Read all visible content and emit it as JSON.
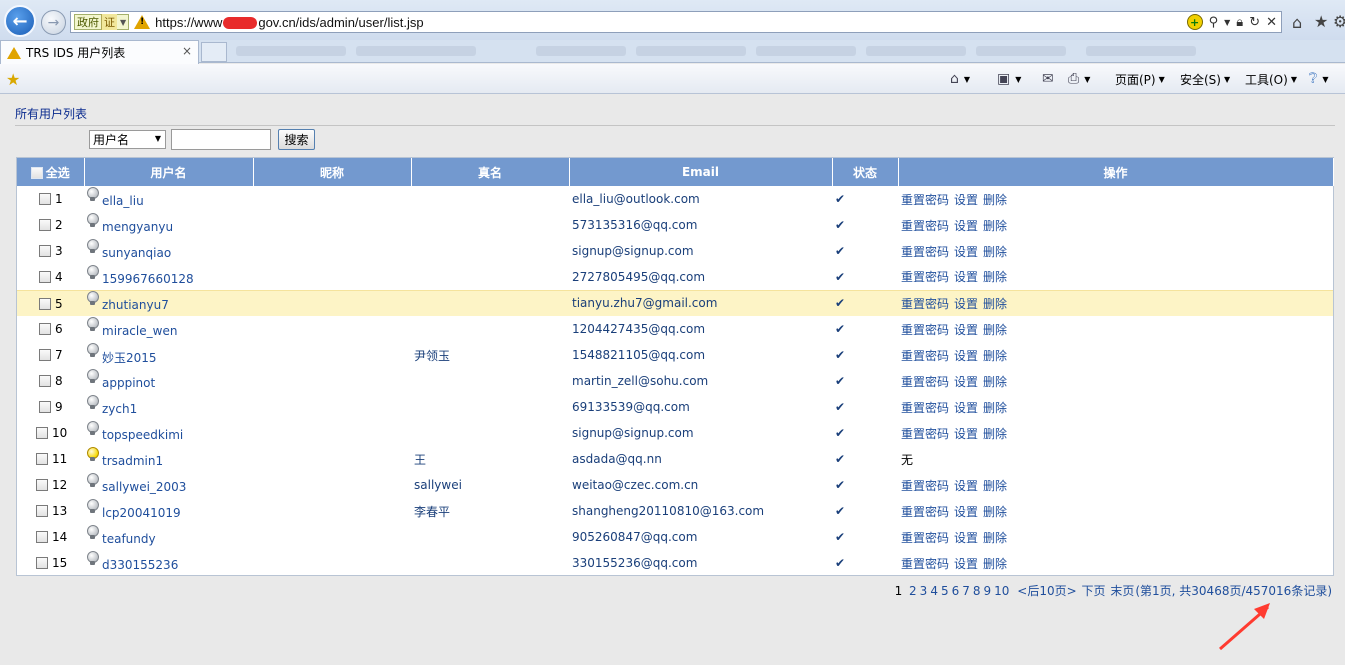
{
  "browser": {
    "cert_label": "政府",
    "cert_sub": "证",
    "url_prefix": "https://www",
    "url_suffix": "gov.cn/ids/admin/user/list.jsp",
    "tab_title": "TRS IDS 用户列表",
    "tab_close": "×",
    "menus": {
      "page": "页面(P)",
      "safety": "安全(S)",
      "tools": "工具(O)"
    }
  },
  "page": {
    "title": "所有用户列表",
    "search_field": "用户名",
    "search_value": "",
    "search_button": "搜索"
  },
  "table": {
    "headers": {
      "select_all": "全选",
      "username": "用户名",
      "nickname": "昵称",
      "realname": "真名",
      "email": "Email",
      "status": "状态",
      "actions": "操作"
    },
    "action_labels": {
      "reset": "重置密码",
      "settings": "设置",
      "delete": "删除",
      "none": "无"
    },
    "status_ok": "✔",
    "rows": [
      {
        "idx": "1",
        "username": "ella_liu",
        "nickname": "",
        "realname": "",
        "email": "ella_liu@outlook.com",
        "bulb": "off",
        "actions": true
      },
      {
        "idx": "2",
        "username": "mengyanyu",
        "nickname": "",
        "realname": "",
        "email": "573135316@qq.com",
        "bulb": "off",
        "actions": true
      },
      {
        "idx": "3",
        "username": "sunyanqiao",
        "nickname": "",
        "realname": "",
        "email": "signup@signup.com",
        "bulb": "off",
        "actions": true
      },
      {
        "idx": "4",
        "username": "159967660128",
        "nickname": "",
        "realname": "",
        "email": "2727805495@qq.com",
        "bulb": "off",
        "actions": true
      },
      {
        "idx": "5",
        "username": "zhutianyu7",
        "nickname": "",
        "realname": "",
        "email": "tianyu.zhu7@gmail.com",
        "bulb": "off",
        "actions": true
      },
      {
        "idx": "6",
        "username": "miracle_wen",
        "nickname": "",
        "realname": "",
        "email": "1204427435@qq.com",
        "bulb": "off",
        "actions": true
      },
      {
        "idx": "7",
        "username": "妙玉2015",
        "nickname": "",
        "realname": "尹领玉",
        "email": "1548821105@qq.com",
        "bulb": "off",
        "actions": true
      },
      {
        "idx": "8",
        "username": "apppinot",
        "nickname": "",
        "realname": "",
        "email": "martin_zell@sohu.com",
        "bulb": "off",
        "actions": true
      },
      {
        "idx": "9",
        "username": "zych1",
        "nickname": "",
        "realname": "",
        "email": "69133539@qq.com",
        "bulb": "off",
        "actions": true
      },
      {
        "idx": "10",
        "username": "topspeedkimi",
        "nickname": "",
        "realname": "",
        "email": "signup@signup.com",
        "bulb": "off",
        "actions": true
      },
      {
        "idx": "11",
        "username": "trsadmin1",
        "nickname": "",
        "realname": "王",
        "email": "asdada@qq.nn",
        "bulb": "on",
        "actions": false
      },
      {
        "idx": "12",
        "username": "sallywei_2003",
        "nickname": "",
        "realname": "sallywei",
        "email": "weitao@czec.com.cn",
        "bulb": "off",
        "actions": true
      },
      {
        "idx": "13",
        "username": "lcp20041019",
        "nickname": "",
        "realname": "李春平",
        "email": "shangheng20110810@163.com",
        "bulb": "off",
        "actions": true
      },
      {
        "idx": "14",
        "username": "teafundy",
        "nickname": "",
        "realname": "",
        "email": "905260847@qq.com",
        "bulb": "off",
        "actions": true
      },
      {
        "idx": "15",
        "username": "d330155236",
        "nickname": "",
        "realname": "",
        "email": "330155236@qq.com",
        "bulb": "off",
        "actions": true
      }
    ]
  },
  "pager": {
    "current": "1",
    "pages": [
      "2",
      "3",
      "4",
      "5",
      "6",
      "7",
      "8",
      "9",
      "10"
    ],
    "next10": "<后10页>",
    "next": "下页",
    "last": "末页",
    "summary": "(第1页, 共30468页/457016条记录)"
  },
  "colors": {
    "header_bg": "#7399cf",
    "highlight_row": "#fdf4c6",
    "link": "#1f4e9c",
    "annotation": "#ff3b30"
  }
}
